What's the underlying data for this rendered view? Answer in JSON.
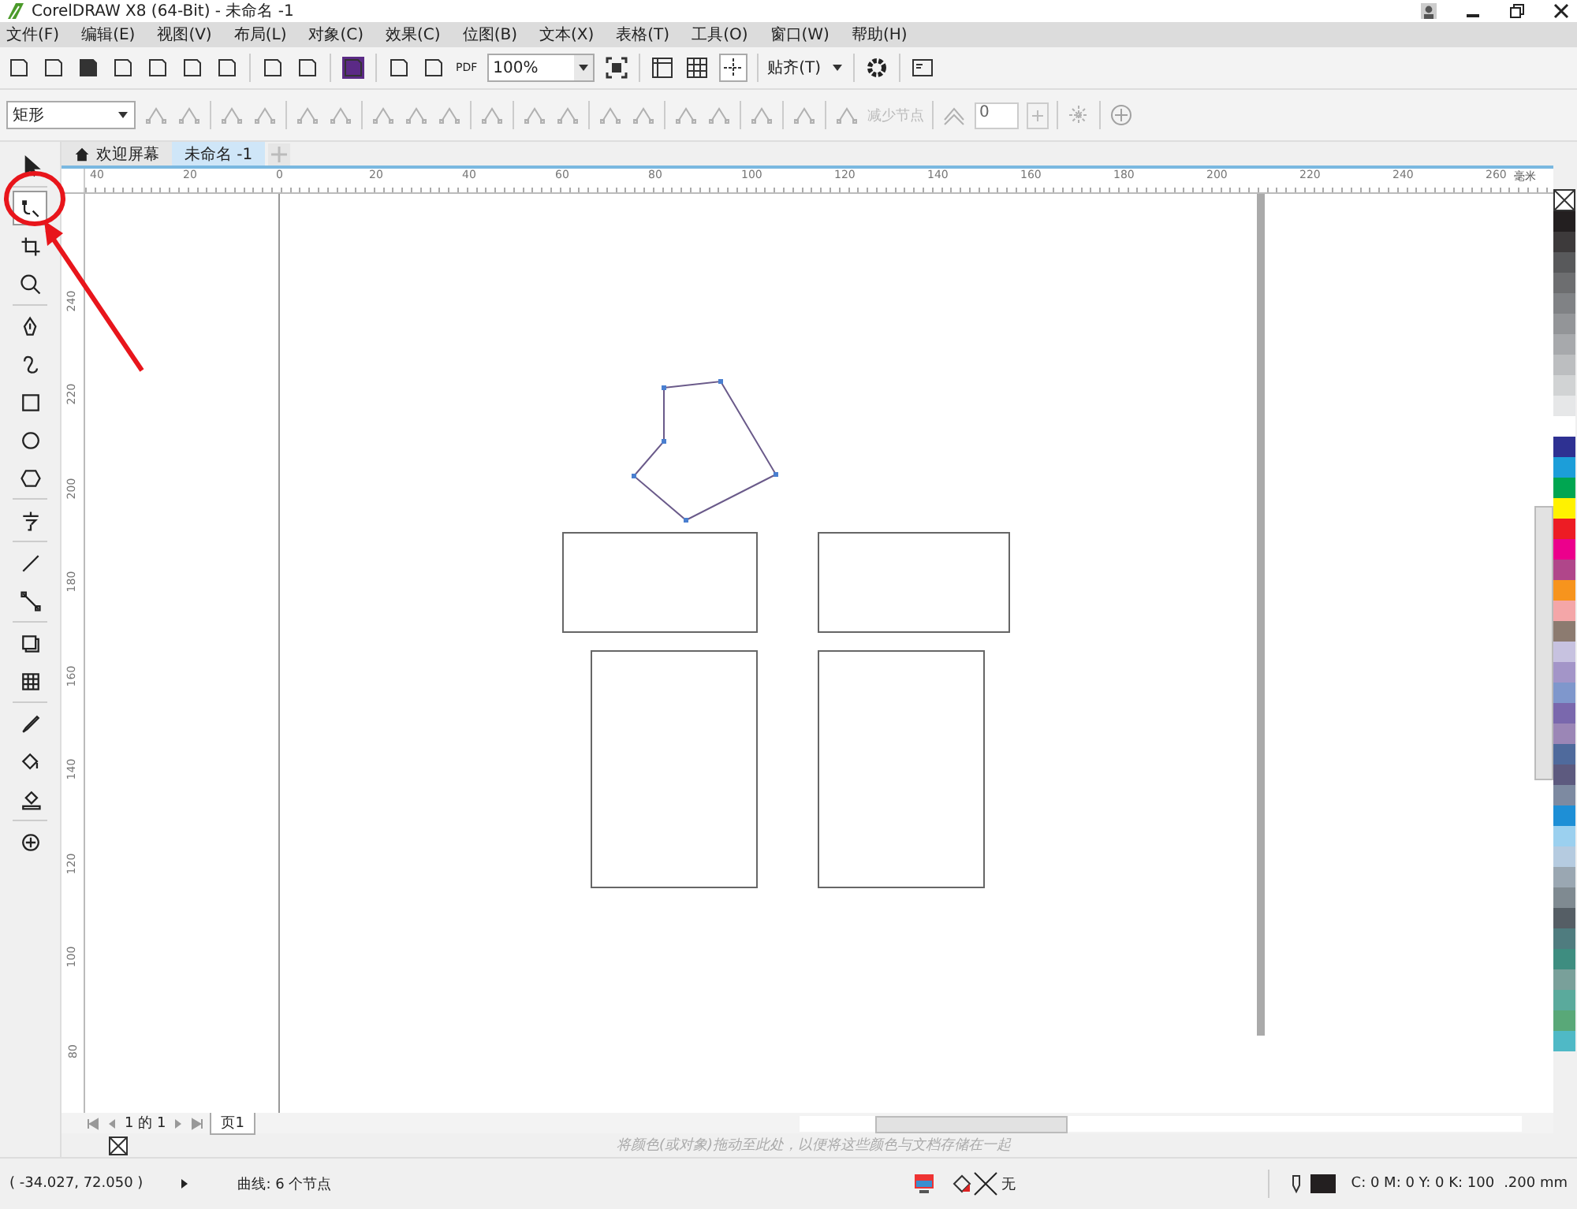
{
  "window": {
    "title": "CorelDRAW X8 (64-Bit) - 未命名 -1"
  },
  "menu": [
    "文件(F)",
    "编辑(E)",
    "视图(V)",
    "布局(L)",
    "对象(C)",
    "效果(C)",
    "位图(B)",
    "文本(X)",
    "表格(T)",
    "工具(O)",
    "窗口(W)",
    "帮助(H)"
  ],
  "toolbar": {
    "pdf_label": "PDF",
    "zoom": "100%",
    "snap": "贴齐(T)"
  },
  "property_bar": {
    "shape_type": "矩形",
    "reduce_nodes": {
      "label": "减少节点",
      "disabled": true
    },
    "smoothness": "0"
  },
  "doc_tabs": [
    {
      "label": "欢迎屏幕",
      "selected": false
    },
    {
      "label": "未命名 -1",
      "selected": true
    }
  ],
  "toolbox": [
    {
      "kind": "pick",
      "selected": false
    },
    {
      "kind": "shape",
      "selected": true
    },
    {
      "kind": "crop",
      "selected": false
    },
    {
      "kind": "zoom",
      "selected": false
    },
    {
      "kind": "pen",
      "selected": false
    },
    {
      "kind": "curve",
      "selected": false
    },
    {
      "kind": "rectangle",
      "selected": false
    },
    {
      "kind": "ellipse",
      "selected": false
    },
    {
      "kind": "polygon",
      "selected": false
    },
    {
      "kind": "text",
      "selected": false
    },
    {
      "kind": "line",
      "selected": false
    },
    {
      "kind": "connector",
      "selected": false
    },
    {
      "kind": "shadow",
      "selected": false
    },
    {
      "kind": "transparency",
      "selected": false
    },
    {
      "kind": "eyedropper",
      "selected": false
    },
    {
      "kind": "fill",
      "selected": false
    },
    {
      "kind": "smartfill",
      "selected": false
    },
    {
      "kind": "add",
      "selected": false
    }
  ],
  "ruler": {
    "horizontal": [
      "40",
      "20",
      "0",
      "20",
      "40",
      "60",
      "80",
      "100",
      "120",
      "140",
      "160",
      "180",
      "200",
      "220",
      "240",
      "260"
    ],
    "unit": "毫米",
    "vertical": [
      "240",
      "220",
      "200",
      "180",
      "160",
      "140",
      "120",
      "100",
      "80"
    ]
  },
  "page_nav": {
    "counter": "1 的 1",
    "pages": [
      {
        "label": "页1",
        "selected": true
      }
    ]
  },
  "palette_hint": "将颜色(或对象)拖动至此处，以便将这些颜色与文档存储在一起",
  "palette": [
    {
      "color": "#231f20"
    },
    {
      "color": "#3d3a3b"
    },
    {
      "color": "#58595b"
    },
    {
      "color": "#6d6e70"
    },
    {
      "color": "#808285"
    },
    {
      "color": "#939598"
    },
    {
      "color": "#a7a9ac"
    },
    {
      "color": "#bcbec0"
    },
    {
      "color": "#d1d3d4"
    },
    {
      "color": "#e6e7e8"
    },
    {
      "color": "#ffffff"
    },
    {
      "color": "#2e3192"
    },
    {
      "color": "#1c9ed9"
    },
    {
      "color": "#00a651"
    },
    {
      "color": "#fff200"
    },
    {
      "color": "#ed1c24"
    },
    {
      "color": "#ec008c"
    },
    {
      "color": "#b0468a"
    },
    {
      "color": "#f7941d"
    },
    {
      "color": "#f4a6a8"
    },
    {
      "color": "#8c7b70"
    },
    {
      "color": "#c7c2e0"
    },
    {
      "color": "#a395c8"
    },
    {
      "color": "#7f97cc"
    },
    {
      "color": "#7a68ad"
    },
    {
      "color": "#9b86b6"
    },
    {
      "color": "#4f6a9c"
    },
    {
      "color": "#5d5a7f"
    },
    {
      "color": "#7d8aa1"
    },
    {
      "color": "#1e8fd6"
    },
    {
      "color": "#9bd0ef"
    },
    {
      "color": "#b5cbe0"
    },
    {
      "color": "#9aa7b2"
    },
    {
      "color": "#7f8a91"
    },
    {
      "color": "#555e65"
    },
    {
      "color": "#4f7c7f"
    },
    {
      "color": "#3e8d80"
    },
    {
      "color": "#79a09a"
    },
    {
      "color": "#5aaa9c"
    },
    {
      "color": "#59a878"
    },
    {
      "color": "#4fb9c6"
    }
  ],
  "status_bar": {
    "coordinates": "( -34.027, 72.050 )",
    "selection": "曲线: 6 个节点",
    "fill": "无",
    "outline": "C: 0 M: 0 Y: 0 K: 100",
    "outline_width": ".200 mm"
  }
}
